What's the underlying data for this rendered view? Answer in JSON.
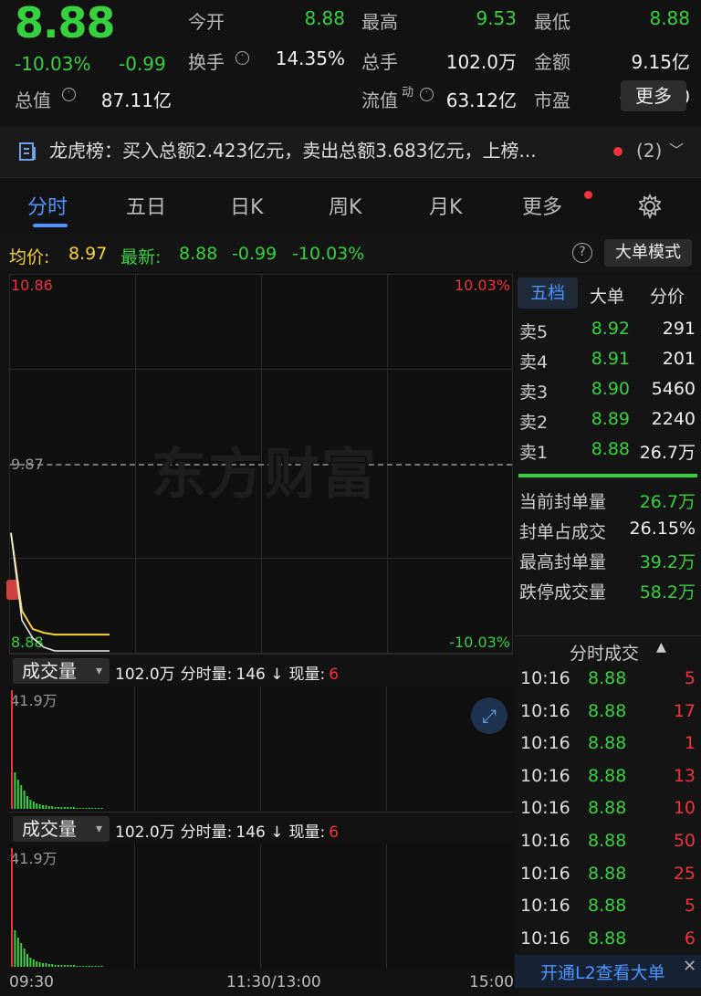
{
  "quote": {
    "price": "8.88",
    "change_pct": "-10.03%",
    "change": "-0.99",
    "stats": [
      {
        "label": "今开",
        "value": "8.88",
        "color": "#37d03f"
      },
      {
        "label": "最高",
        "value": "9.53",
        "color": "#37d03f"
      },
      {
        "label": "最低",
        "value": "8.88",
        "color": "#37d03f"
      },
      {
        "label": "换手",
        "value": "14.35%",
        "color": "#f0f0f0"
      },
      {
        "label": "总手",
        "value": "102.0万",
        "color": "#f0f0f0"
      },
      {
        "label": "金额",
        "value": "9.15亿",
        "color": "#f0f0f0"
      },
      {
        "label": "总值",
        "value": "87.11亿",
        "color": "#f0f0f0"
      },
      {
        "label": "流值",
        "value": "63.12亿",
        "color": "#f0f0f0"
      },
      {
        "label": "市盈",
        "value": "-186.50",
        "color": "#f0f0f0"
      }
    ],
    "pe_sup": "动",
    "more_label": "更多"
  },
  "dragon_tiger": {
    "text": "龙虎榜：买入总额2.423亿元，卖出总额3.683亿元，上榜...",
    "count": "(2)"
  },
  "tabs": [
    "分时",
    "五日",
    "日K",
    "周K",
    "月K",
    "更多"
  ],
  "subheader": {
    "avg_label": "均价:",
    "avg_value": "8.97",
    "latest_label": "最新:",
    "latest_value": "8.88",
    "latest_change": "-0.99",
    "latest_pct": "-10.03%",
    "mode_label": "大单模式"
  },
  "chart": {
    "y_top": "10.86",
    "y_mid": "9.87",
    "y_bottom": "8.88",
    "pct_top": "10.03%",
    "pct_bottom": "-10.03%",
    "watermark": "东方财富",
    "x_labels": [
      "09:30",
      "11:30/13:00",
      "15:00"
    ]
  },
  "chart_data": {
    "type": "line",
    "y_range": [
      8.88,
      10.86
    ],
    "y_reference": 9.87,
    "price_series": [
      9.53,
      9.05,
      8.95,
      8.9,
      8.88,
      8.88,
      8.88,
      8.88,
      8.88,
      8.88
    ],
    "avg_series": [
      9.53,
      9.1,
      9.0,
      8.98,
      8.97,
      8.97,
      8.97,
      8.97,
      8.97,
      8.97
    ]
  },
  "side_tabs": [
    "五档",
    "大单",
    "分价"
  ],
  "order_book": [
    {
      "label": "卖5",
      "price": "8.92",
      "vol": "291"
    },
    {
      "label": "卖4",
      "price": "8.91",
      "vol": "201"
    },
    {
      "label": "卖3",
      "price": "8.90",
      "vol": "5460"
    },
    {
      "label": "卖2",
      "price": "8.89",
      "vol": "2240"
    },
    {
      "label": "卖1",
      "price": "8.88",
      "vol": "26.7万"
    }
  ],
  "seal_stats": [
    {
      "label": "当前封单量",
      "value": "26.7万",
      "color": "#37d03f"
    },
    {
      "label": "封单占成交",
      "value": "26.15%",
      "color": "#f0f0f0"
    },
    {
      "label": "最高封单量",
      "value": "39.2万",
      "color": "#37d03f"
    },
    {
      "label": "跌停成交量",
      "value": "58.2万",
      "color": "#37d03f"
    }
  ],
  "trades_title": "分时成交",
  "trades": [
    {
      "time": "10:16",
      "price": "8.88",
      "vol": "5"
    },
    {
      "time": "10:16",
      "price": "8.88",
      "vol": "17"
    },
    {
      "time": "10:16",
      "price": "8.88",
      "vol": "1"
    },
    {
      "time": "10:16",
      "price": "8.88",
      "vol": "13"
    },
    {
      "time": "10:16",
      "price": "8.88",
      "vol": "10"
    },
    {
      "time": "10:16",
      "price": "8.88",
      "vol": "50"
    },
    {
      "time": "10:16",
      "price": "8.88",
      "vol": "25"
    },
    {
      "time": "10:16",
      "price": "8.88",
      "vol": "5"
    },
    {
      "time": "10:16",
      "price": "8.88",
      "vol": "6"
    }
  ],
  "volume_panels": [
    {
      "selector": "成交量",
      "total": "102.0万",
      "fen_label": "分时量:",
      "fen_value": "146",
      "cur_label": "现量:",
      "cur_value": "6",
      "max": "41.9万"
    },
    {
      "selector": "成交量",
      "total": "102.0万",
      "fen_label": "分时量:",
      "fen_value": "146",
      "cur_label": "现量:",
      "cur_value": "6",
      "max": "41.9万"
    }
  ],
  "l2_banner": "开通L2查看大单"
}
